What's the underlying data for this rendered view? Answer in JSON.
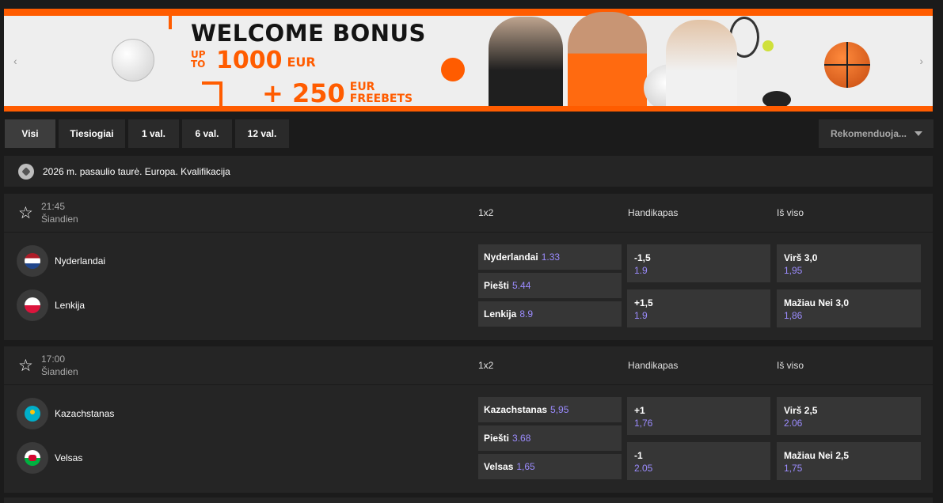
{
  "banner": {
    "title": "WELCOME BONUS",
    "up_to": "UP TO",
    "amount": "1000",
    "currency": "EUR",
    "plus": "+ 250",
    "currency2": "EUR",
    "freebets": "FREEBETS",
    "prev_icon": "‹",
    "next_icon": "›"
  },
  "filters": [
    {
      "label": "Visi",
      "active": true
    },
    {
      "label": "Tiesiogiai",
      "active": false
    },
    {
      "label": "1 val.",
      "active": false
    },
    {
      "label": "6 val.",
      "active": false
    },
    {
      "label": "12 val.",
      "active": false
    }
  ],
  "sort": {
    "label": "Rekomenduoja..."
  },
  "league": {
    "name": "2026 m. pasaulio taurė. Europa. Kvalifikacija",
    "icon": "soccer-ball-icon"
  },
  "markets": {
    "m1": "1x2",
    "m2": "Handikapas",
    "m3": "Iš viso"
  },
  "events": [
    {
      "time": "21:45",
      "day": "Šiandien",
      "home": {
        "name": "Nyderlandai",
        "flag": "netherlands-flag-icon"
      },
      "away": {
        "name": "Lenkija",
        "flag": "poland-flag-icon"
      },
      "x12": [
        {
          "label": "Nyderlandai",
          "odd": "1.33"
        },
        {
          "label": "Piešti",
          "odd": "5.44"
        },
        {
          "label": "Lenkija",
          "odd": "8.9"
        }
      ],
      "handicap": [
        {
          "label": "-1,5",
          "odd": "1.9"
        },
        {
          "label": "+1,5",
          "odd": "1.9"
        }
      ],
      "total": [
        {
          "label": "Virš 3,0",
          "odd": "1,95"
        },
        {
          "label": "Mažiau Nei 3,0",
          "odd": "1,86"
        }
      ]
    },
    {
      "time": "17:00",
      "day": "Šiandien",
      "home": {
        "name": "Kazachstanas",
        "flag": "kazakhstan-flag-icon"
      },
      "away": {
        "name": "Velsas",
        "flag": "wales-flag-icon"
      },
      "x12": [
        {
          "label": "Kazachstanas",
          "odd": "5,95"
        },
        {
          "label": "Piešti",
          "odd": "3.68"
        },
        {
          "label": "Velsas",
          "odd": "1,65"
        }
      ],
      "handicap": [
        {
          "label": "+1",
          "odd": "1,76"
        },
        {
          "label": "-1",
          "odd": "2.05"
        }
      ],
      "total": [
        {
          "label": "Virš 2,5",
          "odd": "2.06"
        },
        {
          "label": "Mažiau Nei 2,5",
          "odd": "1,75"
        }
      ]
    }
  ],
  "colors": {
    "odd_value": "#9c8cff",
    "accent": "#ff5c00",
    "card": "#252525",
    "button": "#363636"
  }
}
